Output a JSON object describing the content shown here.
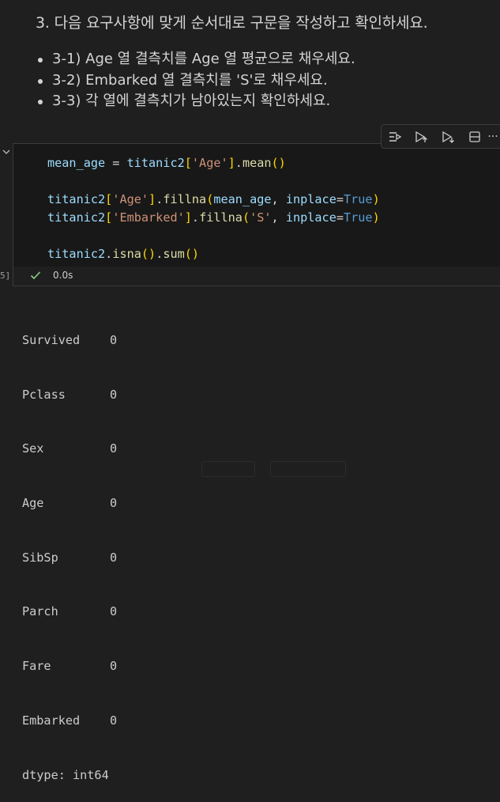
{
  "markdown": {
    "heading": "3. 다음 요구사항에 맞게 순서대로 구문을 작성하고 확인하세요.",
    "items": [
      "3-1) Age 열 결측치를 Age 열 평균으로 채우세요.",
      "3-2) Embarked 열 결측치를 'S'로 채우세요.",
      "3-3) 각 열에 결측치가 남아있는지 확인하세요."
    ]
  },
  "toolbar": {
    "icons": [
      "run-by-line-icon",
      "execute-above-icon",
      "execute-below-icon",
      "split-cell-icon",
      "more-icon"
    ],
    "more": "···"
  },
  "cell": {
    "exec_count": "5]",
    "status_time": "0.0s",
    "code": {
      "l1_var": "mean_age",
      "l1_op": " = ",
      "l1_obj": "titanic2",
      "l1_str": "'Age'",
      "l1_fn": "mean",
      "l2_obj": "titanic2",
      "l2_str": "'Age'",
      "l2_fn": "fillna",
      "l2_arg": "mean_age",
      "l2_kw": "inplace",
      "l2_val": "True",
      "l3_obj": "titanic2",
      "l3_str": "'Embarked'",
      "l3_fn": "fillna",
      "l3_arg": "'S'",
      "l3_kw": "inplace",
      "l3_val": "True",
      "l4_obj": "titanic2",
      "l4_fn1": "isna",
      "l4_fn2": "sum"
    }
  },
  "output": {
    "rows": [
      {
        "key": "Survived",
        "value": "0"
      },
      {
        "key": "Pclass",
        "value": "0"
      },
      {
        "key": "Sex",
        "value": "0"
      },
      {
        "key": "Age",
        "value": "0"
      },
      {
        "key": "SibSp",
        "value": "0"
      },
      {
        "key": "Parch",
        "value": "0"
      },
      {
        "key": "Fare",
        "value": "0"
      },
      {
        "key": "Embarked",
        "value": "0"
      }
    ],
    "dtype": "dtype: int64"
  }
}
